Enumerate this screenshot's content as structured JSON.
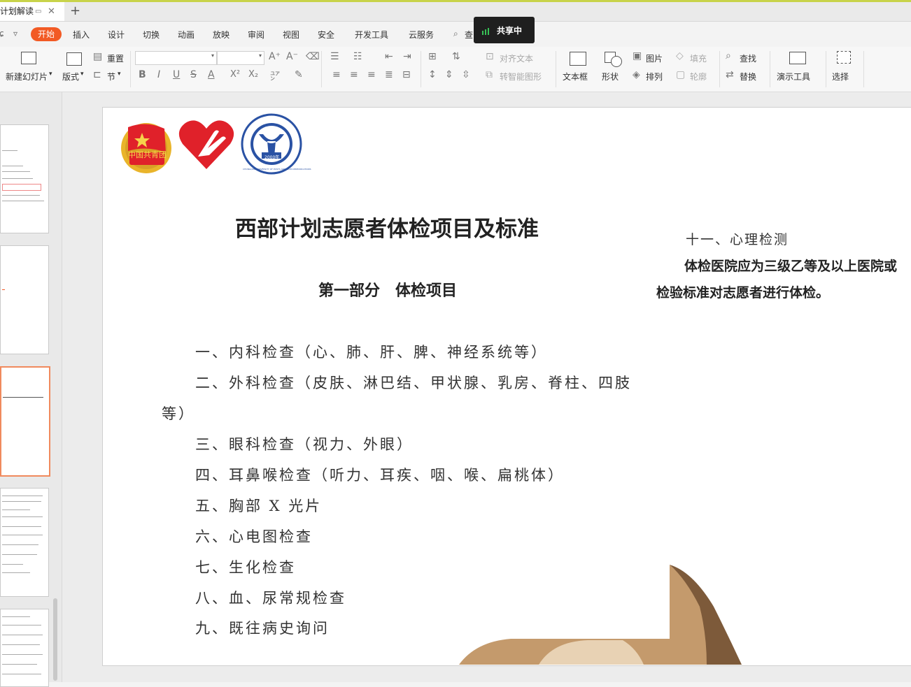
{
  "window": {
    "doc_tab_title": "计划解读",
    "new_tab": "+",
    "close_glyph": "✕"
  },
  "menu": {
    "home": "开始",
    "items": [
      "插入",
      "设计",
      "切换",
      "动画",
      "放映",
      "审阅",
      "视图",
      "安全",
      "开发工具",
      "云服务"
    ],
    "search_partial": "查",
    "undo_glyph": "ɕ",
    "dropdown_glyph": "▿"
  },
  "sharing": {
    "label": "共享中",
    "color": "#37c256"
  },
  "ribbon": {
    "new_slide": "新建幻灯片",
    "layout": "版式",
    "reset": "重置",
    "section": "节",
    "bold": "B",
    "italic": "I",
    "underline": "U",
    "strike": "S",
    "font_color": "A",
    "superscript": "X²",
    "subscript": "X₂",
    "align_text": "对齐文本",
    "smart_shape": "转智能图形",
    "textbox": "文本框",
    "shape": "形状",
    "picture": "图片",
    "arrange": "排列",
    "fill": "填充",
    "outline": "轮廓",
    "find": "查找",
    "replace": "替换",
    "present_tools": "演示工具",
    "select": "选择"
  },
  "slide": {
    "title": "西部计划志愿者体检项目及标准",
    "part1": "第一部分　体检项目",
    "items": [
      "一、内科检查（心、肺、肝、脾、神经系统等）",
      "二、外科检查（皮肤、淋巴结、甲状腺、乳房、脊柱、四肢",
      "等）",
      "三、眼科检查（视力、外眼）",
      "四、耳鼻喉检查（听力、耳疾、咽、喉、扁桃体）",
      "五、胸部 X 光片",
      "六、心电图检查",
      "七、生化检查",
      "八、血、尿常规检查",
      "九、既往病史询问"
    ],
    "item11": "十一、心理检测",
    "right_para_1": "体检医院应为三级乙等及以上医院或",
    "right_para_2": "检验标准对志愿者进行体检。",
    "logo_youth_league": "中国共青团",
    "logo_university_year": "2000年",
    "logo_university_ring": "CHONGQING UNIVERSITY OF POSTS AND TELECOMMUNICATIONS"
  },
  "colors": {
    "accent": "#f25a24",
    "slide_bg": "#ffffff",
    "red_logo": "#e0212a",
    "blue_logo": "#2a52a4"
  }
}
